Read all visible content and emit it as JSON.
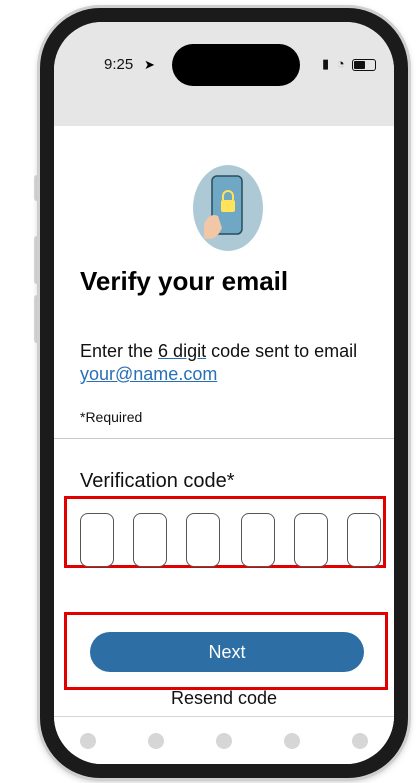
{
  "status": {
    "time": "9:25",
    "signal_icon": "signal-icon",
    "wifi_icon": "wifi-icon",
    "battery_icon": "battery-icon"
  },
  "header": {
    "title": "Verify your email"
  },
  "instructions": {
    "prefix": "Enter the ",
    "digits_text": "6 digit",
    "middle": " code sent to email ",
    "email": "your@name.com"
  },
  "required_note": "*Required",
  "code_field": {
    "label": "Verification code*",
    "digits": [
      "",
      "",
      "",
      "",
      "",
      ""
    ]
  },
  "actions": {
    "next_label": "Next",
    "resend_label": "Resend code"
  },
  "colors": {
    "accent": "#2d6ea5",
    "link": "#2a6fb6",
    "highlight": "#e00000"
  }
}
